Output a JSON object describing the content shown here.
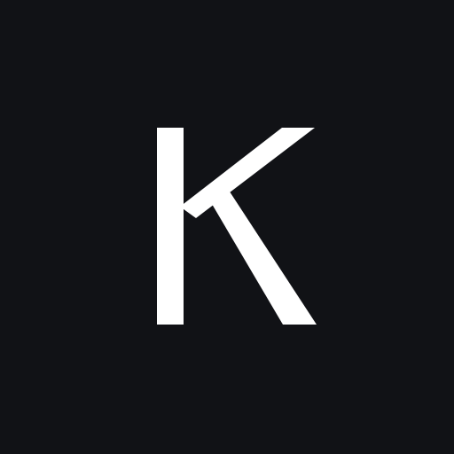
{
  "app_icon": {
    "letter": "K",
    "background_color": "#111216",
    "letter_color": "#ffffff",
    "icon_name": "letter-k-monogram-icon"
  }
}
